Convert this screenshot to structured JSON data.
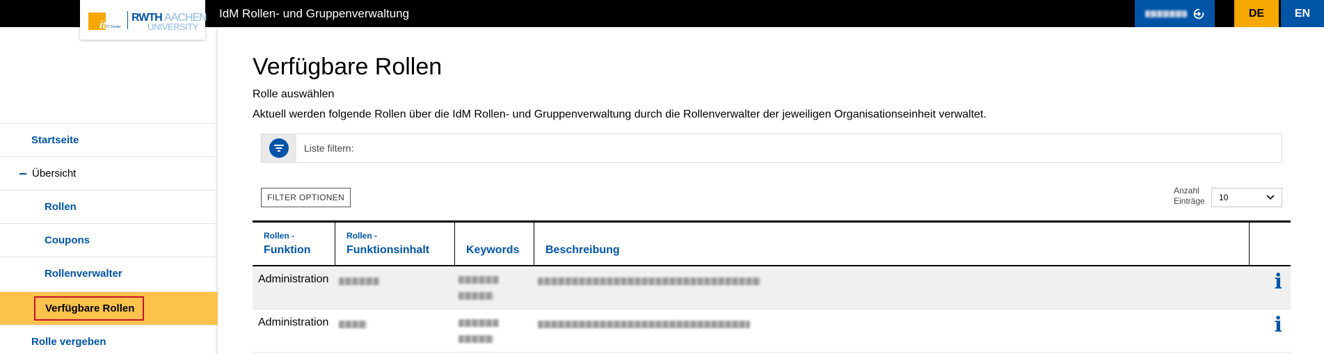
{
  "header": {
    "app_title": "IdM Rollen- und Gruppenverwaltung",
    "user_name": "",
    "lang_de": "DE",
    "lang_en": "EN"
  },
  "logo": {
    "it_text": "it",
    "it_sub": "IT Center",
    "rwth": "RWTH",
    "aachen": "AACHEN",
    "university": "UNIVERSITY"
  },
  "sidebar": {
    "items": [
      {
        "label": "Startseite"
      },
      {
        "label": "Übersicht"
      },
      {
        "label": "Rollen"
      },
      {
        "label": "Coupons"
      },
      {
        "label": "Rollenverwalter"
      },
      {
        "label": "Verfügbare Rollen"
      },
      {
        "label": "Rolle vergeben"
      }
    ]
  },
  "main": {
    "title": "Verfügbare Rollen",
    "subtitle": "Rolle auswählen",
    "description": "Aktuell werden folgende Rollen über die IdM Rollen- und Gruppenverwaltung durch die Rollenverwalter der jeweiligen Organisationseinheit verwaltet.",
    "filter_label": "Liste filtern:",
    "filter_value": "",
    "filter_options_label": "FILTER OPTIONEN",
    "entries_label": "Anzahl Einträge",
    "entries_value": "10"
  },
  "table": {
    "columns": [
      {
        "small": "Rollen -",
        "big": "Funktion"
      },
      {
        "small": "Rollen -",
        "big": "Funktionsinhalt"
      },
      {
        "small": "",
        "big": "Keywords"
      },
      {
        "small": "",
        "big": "Beschreibung"
      }
    ],
    "rows": [
      {
        "funktion": "Administration",
        "inhalt": "",
        "keywords": "",
        "beschreibung": ""
      },
      {
        "funktion": "Administration",
        "inhalt": "",
        "keywords": "",
        "beschreibung": ""
      }
    ],
    "info_glyph": "i"
  },
  "colors": {
    "brand_blue": "#0054a6",
    "accent_yellow": "#f6a800",
    "active_nav": "#fbc24c",
    "highlight_border": "#c8102e"
  }
}
